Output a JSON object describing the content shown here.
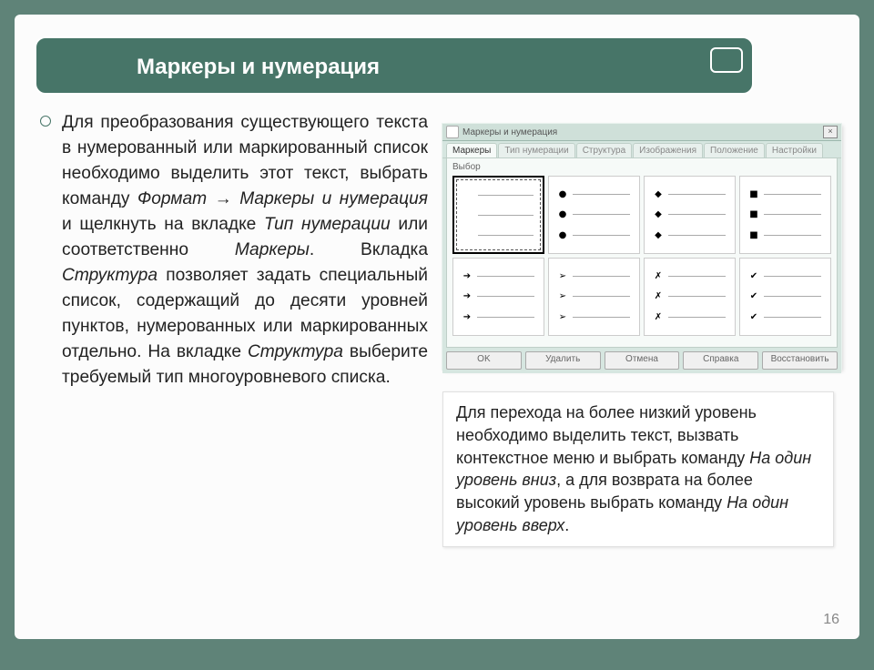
{
  "title": "Маркеры и нумерация",
  "body": {
    "p1": "Для преобразования существующего текста в нумерованный или маркированный список необходимо выделить этот текст, выбрать команду ",
    "i1": "Формат → Маркеры и нумерация",
    "p2": " и щелкнуть на вкладке ",
    "i2": "Тип нумерации",
    "p3": " или соответственно ",
    "i3": "Маркеры",
    "p4": ". Вкладка ",
    "i4": "Структура",
    "p5": " позволяет задать специальный список, содержащий до десяти уровней пунктов, нумерованных или маркированных отдельно. На вкладке ",
    "i5": "Структура",
    "p6": " выберите требуемый тип многоуровневого списка."
  },
  "dialog": {
    "title": "Маркеры и нумерация",
    "tabs": [
      "Маркеры",
      "Тип нумерации",
      "Структура",
      "Изображения",
      "Положение",
      "Настройки"
    ],
    "section_label": "Выбор",
    "options": [
      {
        "sym": "",
        "selected": true
      },
      {
        "sym": "●"
      },
      {
        "sym": "◆"
      },
      {
        "sym": "■"
      },
      {
        "sym": "➔"
      },
      {
        "sym": "➢"
      },
      {
        "sym": "✗"
      },
      {
        "sym": "✔"
      }
    ],
    "buttons": [
      "OK",
      "Удалить",
      "Отмена",
      "Справка",
      "Восстановить"
    ]
  },
  "note": {
    "p1": "Для перехода на более низкий уровень необходимо выделить текст, вызвать контекстное меню и выбрать команду ",
    "i1": "На один уровень вниз",
    "p2": ", а для возврата на более высокий уровень выбрать команду ",
    "i2": "На один уровень вверх",
    "p3": "."
  },
  "page_number": "16"
}
